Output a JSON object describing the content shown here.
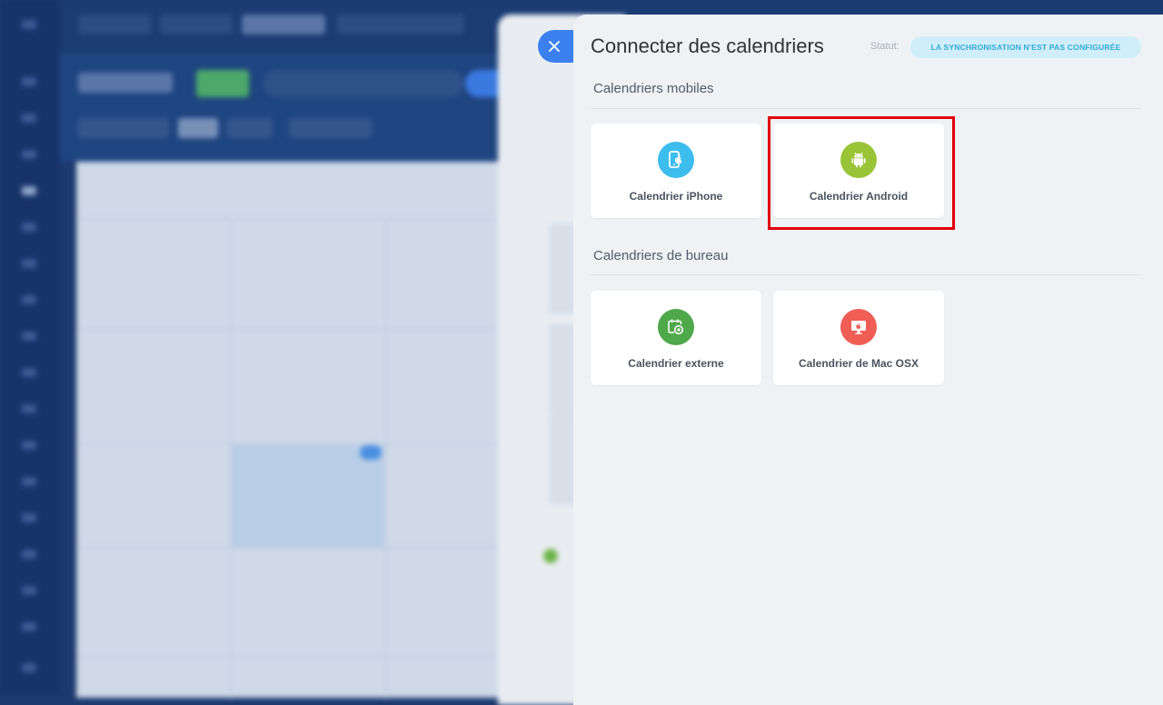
{
  "close_button": {
    "icon": "close-icon"
  },
  "panel": {
    "title": "Connecter des calendriers",
    "status_label": "Statut:",
    "status_value": "LA SYNCHRONISATION N'EST PAS CONFIGURÉE"
  },
  "sections": {
    "mobile": {
      "title": "Calendriers mobiles",
      "cards": [
        {
          "label": "Calendrier iPhone",
          "icon": "iphone-icon",
          "icon_color": "#3dbdee"
        },
        {
          "label": "Calendrier Android",
          "icon": "android-icon",
          "icon_color": "#9ac437"
        }
      ]
    },
    "desktop": {
      "title": "Calendriers de bureau",
      "cards": [
        {
          "label": "Calendrier externe",
          "icon": "external-calendar-icon",
          "icon_color": "#4fa84a"
        },
        {
          "label": "Calendrier de Mac OSX",
          "icon": "mac-osx-icon",
          "icon_color": "#f05d55"
        }
      ]
    }
  },
  "colors": {
    "accent": "#3c80f0",
    "highlight": "#e1000a",
    "status_badge_bg": "#cfeefa",
    "status_badge_text": "#2fa9d6"
  }
}
